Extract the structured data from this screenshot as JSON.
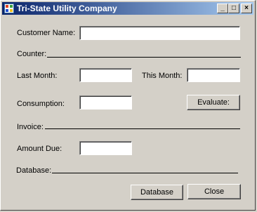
{
  "window": {
    "title": "Tri-State Utility Company",
    "controls": {
      "minimize": "_",
      "maximize": "□",
      "close": "×"
    }
  },
  "form": {
    "customer_name_label": "Customer Name:",
    "customer_name_value": "",
    "counter_label": "Counter:",
    "last_month_label": "Last Month:",
    "last_month_value": "",
    "this_month_label": "This Month:",
    "this_month_value": "",
    "consumption_label": "Consumption:",
    "consumption_value": "",
    "evaluate_label": "Evaluate:",
    "invoice_label": "Invoice:",
    "amount_due_label": "Amount Due:",
    "amount_due_value": "",
    "database_label": "Database:",
    "database_button": "Database",
    "close_button": "Close"
  }
}
